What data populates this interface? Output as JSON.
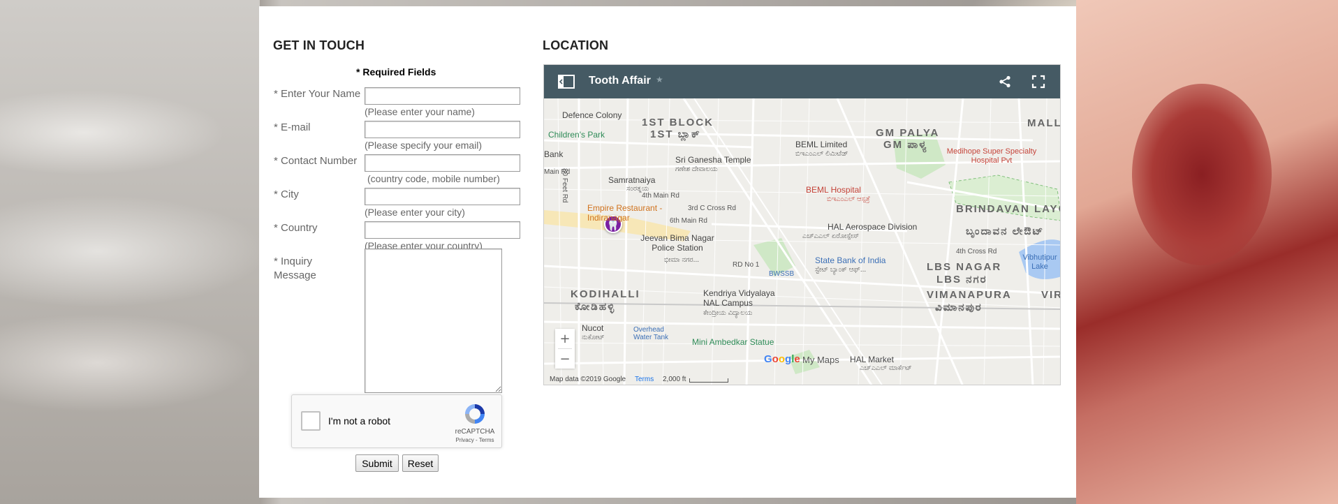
{
  "contact": {
    "title": "GET IN TOUCH",
    "required_note": "* Required Fields",
    "fields": [
      {
        "label": "* Enter Your Name",
        "hint": "(Please enter your name)",
        "value": ""
      },
      {
        "label": "* E-mail",
        "hint": "(Please specify your email)",
        "value": ""
      },
      {
        "label": "* Contact Number",
        "hint": "(country code, mobile number)",
        "value": ""
      },
      {
        "label": "* City",
        "hint": "(Please enter your city)",
        "value": ""
      },
      {
        "label": "* Country",
        "hint": "(Please enter your country)",
        "value": ""
      }
    ],
    "message_label": "* Inquiry Message",
    "recaptcha": {
      "label": "I'm not a robot",
      "brand": "reCAPTCHA",
      "links": "Privacy - Terms"
    },
    "submit_label": "Submit",
    "reset_label": "Reset"
  },
  "location": {
    "title": "LOCATION",
    "map": {
      "title": "Tooth Affair",
      "star": "★",
      "zoom_in": "+",
      "zoom_out": "−",
      "footer_data": "Map data ©2019 Google",
      "footer_terms": "Terms",
      "scale": "2,000 ft",
      "brand": "Google",
      "brand_suffix": "My Maps",
      "labels": [
        {
          "text": "Defence Colony",
          "cls": "dark"
        },
        {
          "text": "Children's Park",
          "cls": "green"
        },
        {
          "text": "1ST BLOCK",
          "cls": "big"
        },
        {
          "text": "1ST ಬ್ಲಾಕ್",
          "cls": "big"
        },
        {
          "text": "Sri Ganesha Temple",
          "cls": "dark"
        },
        {
          "text": "ಗಣೇಶ ದೇವಾಲಯ",
          "cls": "small"
        },
        {
          "text": "BEML Limited",
          "cls": "dark"
        },
        {
          "text": "ಬಿಇಎಂಎಲ್ ಲಿಮಿಟೆಡ್",
          "cls": "small"
        },
        {
          "text": "GM PALYA",
          "cls": "big"
        },
        {
          "text": "GM ಪಾಳ್ಯ",
          "cls": "big"
        },
        {
          "text": "MALLE",
          "cls": "big"
        },
        {
          "text": "Medihope Super Specialty Hospital Pvt",
          "cls": "red"
        },
        {
          "text": "Samratnaiya",
          "cls": "dark"
        },
        {
          "text": "ಸಂರತ್ನಯ",
          "cls": "small"
        },
        {
          "text": "BEML Hospital",
          "cls": "red"
        },
        {
          "text": "ಬಿಇಎಂಎಲ್ ಆಸ್ಪತ್ರೆ",
          "cls": "red"
        },
        {
          "text": "Empire Restaurant - Indiranagar",
          "cls": "orange"
        },
        {
          "text": "BRINDAVAN LAYOUT",
          "cls": "big"
        },
        {
          "text": "ಬೃಂದಾವನ ಲೇಔಟ್",
          "cls": "big"
        },
        {
          "text": "HAL Aerospace Division",
          "cls": "dark"
        },
        {
          "text": "ಎಚ್ಎಎಲ್ ಏರೋಸ್ಪೇಸ್",
          "cls": "small"
        },
        {
          "text": "Jeevan Bima Nagar Police Station",
          "cls": "dark"
        },
        {
          "text": "ಭೀಮಾ ನಗರ...",
          "cls": "small"
        },
        {
          "text": "State Bank of India",
          "cls": "blue"
        },
        {
          "text": "ಸ್ಟೇಟ್ ಬ್ಯಾಂಕ್ ಆಫ್...",
          "cls": "small"
        },
        {
          "text": "LBS NAGAR",
          "cls": "big"
        },
        {
          "text": "LBS ನಗರ",
          "cls": "big"
        },
        {
          "text": "Vibhutipur Lake",
          "cls": "blue"
        },
        {
          "text": "KODIHALLI",
          "cls": "big"
        },
        {
          "text": "ಕೋಡಿಹಳ್ಳಿ",
          "cls": "big"
        },
        {
          "text": "Kendriya Vidyalaya NAL Campus",
          "cls": "dark"
        },
        {
          "text": "ಕೇಂದ್ರೀಯ ವಿದ್ಯಾಲಯ",
          "cls": "small"
        },
        {
          "text": "VIMANAPURA",
          "cls": "big"
        },
        {
          "text": "ವಿಮಾನಪುರ",
          "cls": "big"
        },
        {
          "text": "Nucot",
          "cls": "dark"
        },
        {
          "text": "ನುಕೋಟ್",
          "cls": "small"
        },
        {
          "text": "Overhead Water Tank",
          "cls": "blue"
        },
        {
          "text": "Mini Ambedkar Statue",
          "cls": "green"
        },
        {
          "text": "HAL Market",
          "cls": "dark"
        },
        {
          "text": "ಎಚ್ಎಎಲ್ ಮಾರ್ಕೆಟ್",
          "cls": "small"
        },
        {
          "text": "BWSSB",
          "cls": "blue"
        },
        {
          "text": "80 Feet Rd",
          "cls": "small"
        },
        {
          "text": "6th Main Rd",
          "cls": "small"
        },
        {
          "text": "4th Main Rd",
          "cls": "small"
        },
        {
          "text": "3rd C Cross Rd",
          "cls": "small"
        },
        {
          "text": "RD No 1",
          "cls": "small"
        },
        {
          "text": "Bank",
          "cls": "dark"
        },
        {
          "text": "Main Rd",
          "cls": "small"
        },
        {
          "text": "4th Cross Rd",
          "cls": "small"
        },
        {
          "text": "VIR",
          "cls": "big"
        }
      ]
    }
  }
}
